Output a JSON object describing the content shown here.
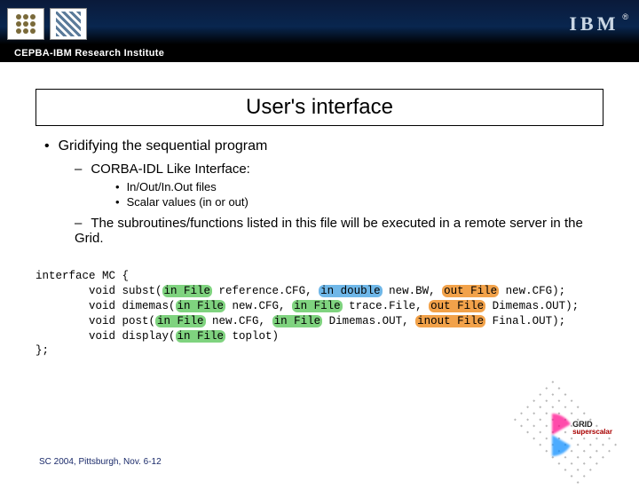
{
  "header": {
    "institute": "CEPBA-IBM Research Institute",
    "ibm": "IBM",
    "reg": "®"
  },
  "title": "User's interface",
  "bullets": {
    "l1": "Gridifying the sequential program",
    "l2a": "CORBA-IDL Like Interface:",
    "l3a": "In/Out/In.Out files",
    "l3b": "Scalar values (in or out)",
    "l2b": "The subroutines/functions listed in this file will be executed in a remote server in the Grid."
  },
  "code": {
    "line1": "interface MC {",
    "l2_pre": "        void subst(",
    "l2_h1": "in File",
    "l2_m1": " reference.CFG, ",
    "l2_h2": "in double",
    "l2_m2": " new.BW, ",
    "l2_h3": "out File",
    "l2_end": " new.CFG);",
    "l3_pre": "        void dimemas(",
    "l3_h1": "in File",
    "l3_m1": " new.CFG, ",
    "l3_h2": "in File",
    "l3_m2": " trace.File, ",
    "l3_h3": "out File",
    "l3_end": " Dimemas.OUT);",
    "l4_pre": "        void post(",
    "l4_h1": "in File",
    "l4_m1": " new.CFG, ",
    "l4_h2": "in File",
    "l4_m2": " Dimemas.OUT, ",
    "l4_h3": "inout File",
    "l4_end": " Final.OUT);",
    "l5_pre": "        void display(",
    "l5_h1": "in File",
    "l5_end": " toplot)",
    "line6": "};"
  },
  "footer": "SC 2004, Pittsburgh, Nov. 6-12",
  "gridlogo": {
    "top": "GRID",
    "bottom": "superscalar"
  }
}
